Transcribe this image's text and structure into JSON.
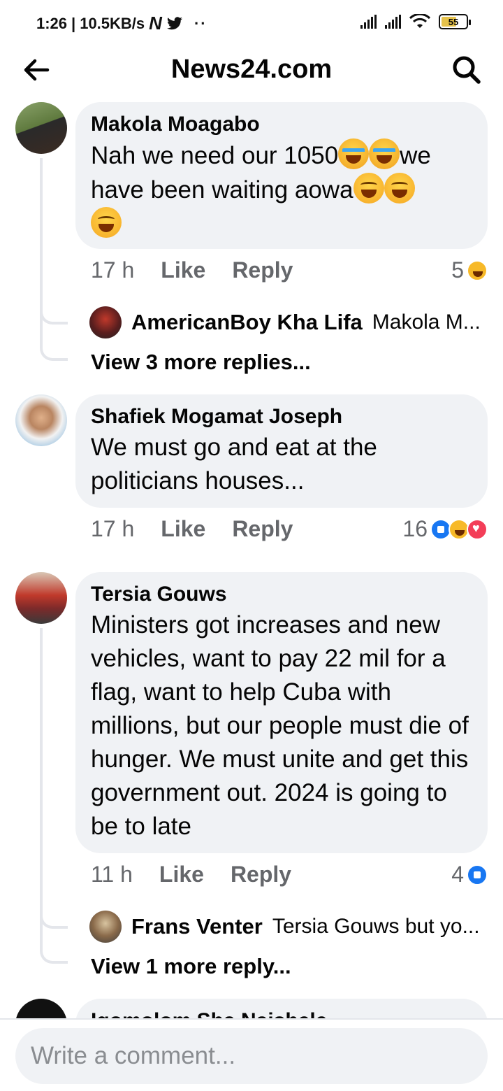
{
  "status_bar": {
    "time": "1:26",
    "speed": "10.5KB/s",
    "battery": "55"
  },
  "header": {
    "title": "News24.com"
  },
  "comments": [
    {
      "author": "Makola Moagabo",
      "text_1": "Nah we need our 1050",
      "text_2": "we",
      "text_3": "have been waiting aowa",
      "time": "17 h",
      "like": "Like",
      "reply": "Reply",
      "reaction_count": "5",
      "reply_preview": {
        "author": "AmericanBoy Kha Lifa",
        "text": "Makola M..."
      },
      "more_replies": "View 3 more replies..."
    },
    {
      "author": "Shafiek Mogamat Joseph",
      "text": "We must go and eat at the politicians houses...",
      "time": "17 h",
      "like": "Like",
      "reply": "Reply",
      "reaction_count": "16"
    },
    {
      "author": "Tersia Gouws",
      "text": "Ministers got increases and new vehicles, want to pay 22 mil for a flag, want to help Cuba with millions, but our people must die of hunger. We must unite and get this government out. 2024 is going to be to late",
      "time": "11 h",
      "like": "Like",
      "reply": "Reply",
      "reaction_count": "4",
      "reply_preview": {
        "author": "Frans Venter",
        "text": "Tersia Gouws but yo..."
      },
      "more_replies": "View 1 more reply..."
    },
    {
      "author": "Igomolom Sha Naishele"
    }
  ],
  "composer": {
    "placeholder": "Write a comment..."
  },
  "colors": {
    "bubble": "#f0f2f5",
    "meta": "#65676b",
    "like_blue": "#1877f2",
    "love_red": "#f33e58"
  }
}
